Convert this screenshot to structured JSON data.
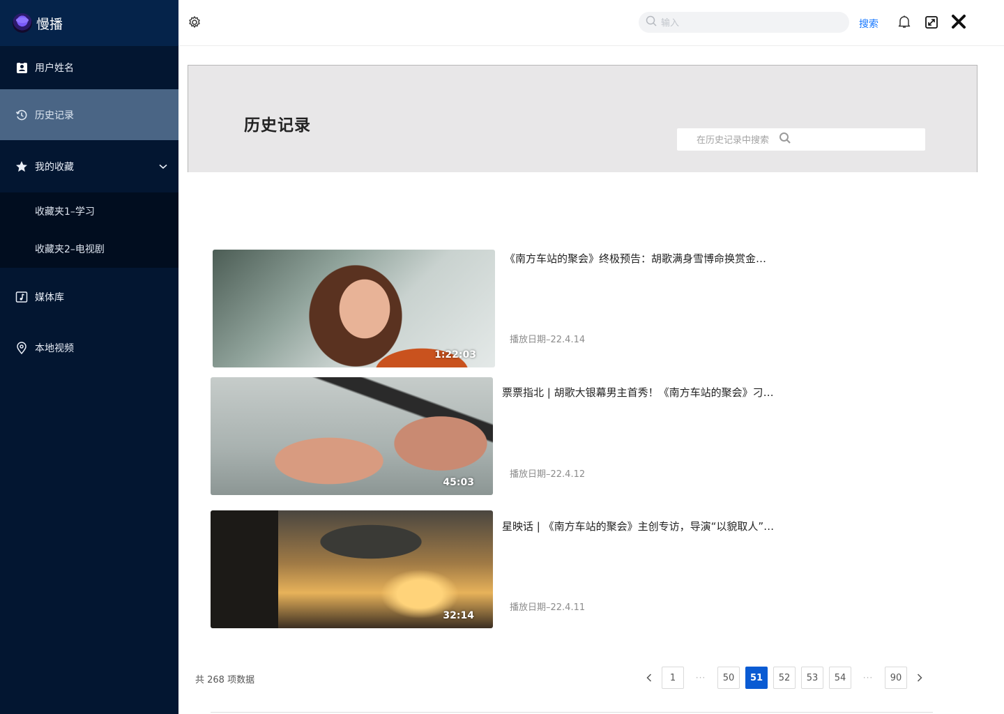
{
  "brand": {
    "name": "慢播"
  },
  "sidebar": {
    "user": "用户姓名",
    "history": "历史记录",
    "favorites": "我的收藏",
    "favorite_folders": [
      "收藏夹1–学习",
      "收藏夹2–电视剧"
    ],
    "media_library": "媒体库",
    "local_video": "本地视频"
  },
  "topbar": {
    "search_placeholder": "输入",
    "search_button": "搜索"
  },
  "banner": {
    "title": "历史记录",
    "search_placeholder": "在历史记录中搜索"
  },
  "videos": [
    {
      "title": "《南方车站的聚会》终极预告：胡歌满身雪博命换赏金…",
      "date": "播放日期–22.4.14",
      "duration": "1:22:03"
    },
    {
      "title": "票票指北 | 胡歌大银幕男主首秀！《南方车站的聚会》刁…",
      "date": "播放日期–22.4.12",
      "duration": "45:03"
    },
    {
      "title": "星映话 | 《南方车站的聚会》主创专访，导演“以貌取人”…",
      "date": "播放日期–22.4.11",
      "duration": "32:14"
    }
  ],
  "pagination": {
    "total_text": "共 268 项数据",
    "pages": [
      "1",
      "50",
      "51",
      "52",
      "53",
      "54",
      "90"
    ],
    "current": "51",
    "ellipsis": "···"
  },
  "colors": {
    "sidebar_bg": "#031631",
    "active_item_bg": "#4a6585",
    "accent": "#1677ff",
    "page_active": "#0a5bd3"
  }
}
